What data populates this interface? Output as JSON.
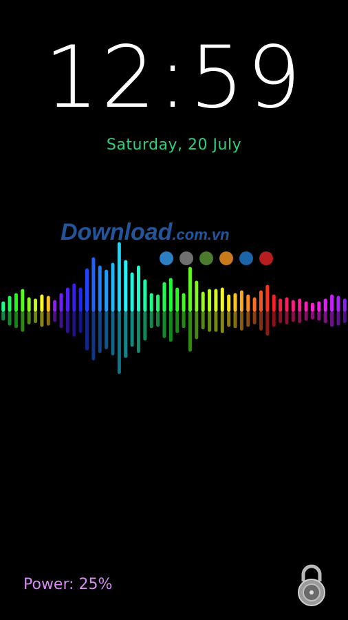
{
  "clock": {
    "time": "12:59"
  },
  "date": {
    "text": "Saturday, 20 July"
  },
  "watermark": {
    "text": "Download",
    "tld": ".com.vn"
  },
  "dot_colors": [
    "#2d7fc4",
    "#6f6f6f",
    "#4a7c2c",
    "#c97a1b",
    "#1d63a8",
    "#b81e1e"
  ],
  "power": {
    "text": "Power: 25%"
  },
  "icons": {
    "lock": "padlock-icon"
  },
  "colors": {
    "date": "#2fd07a",
    "power": "#d78bf2"
  }
}
